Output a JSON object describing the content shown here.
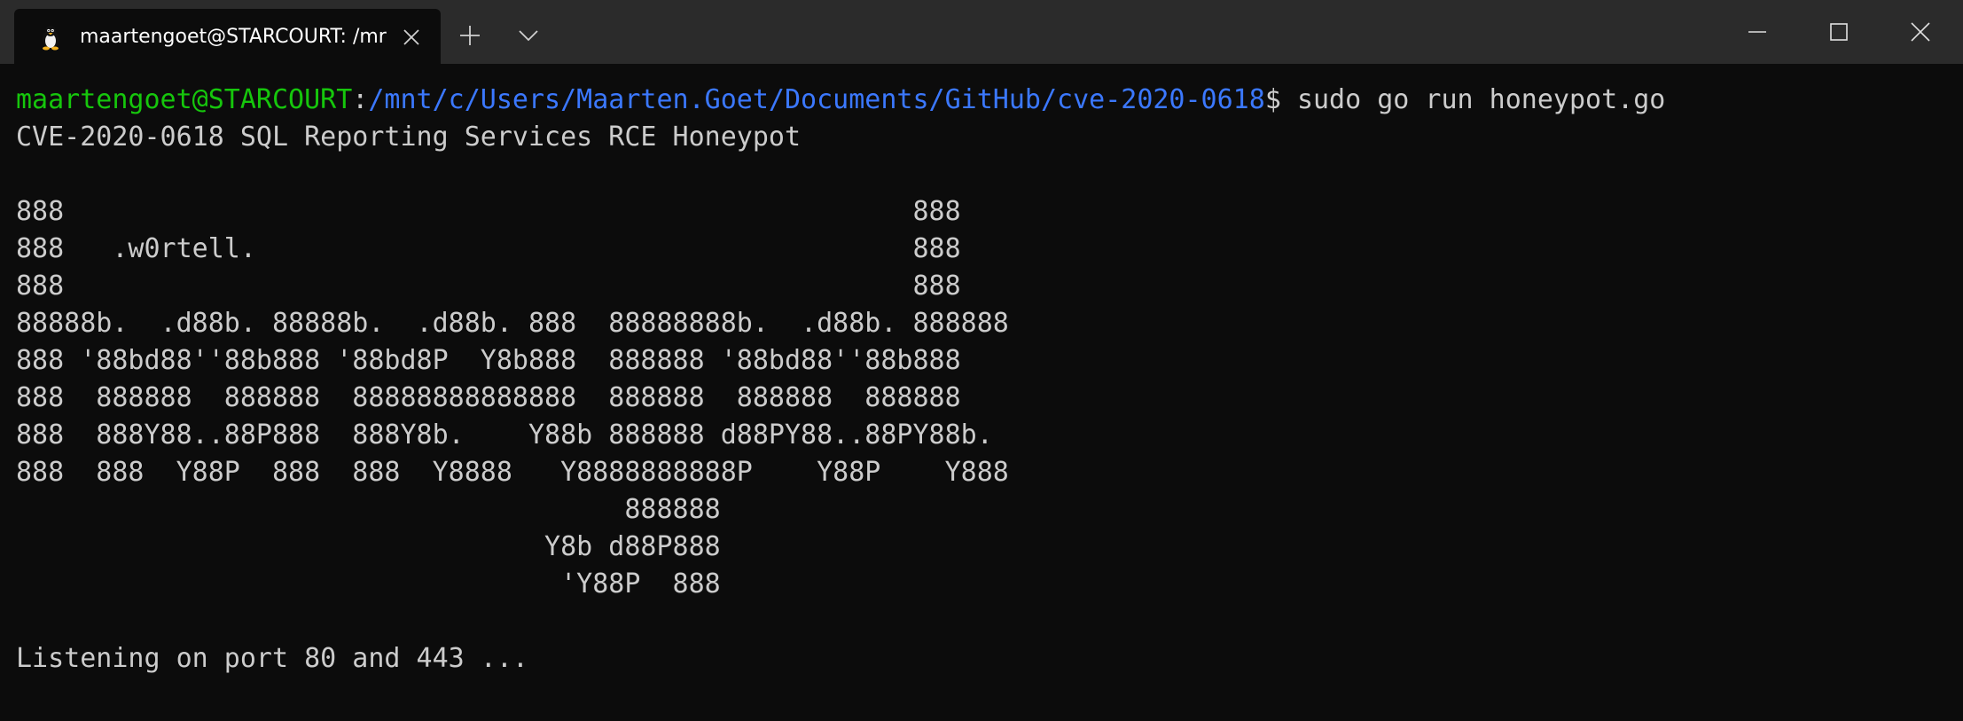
{
  "window": {
    "tab_title": "maartengoet@STARCOURT: /mr",
    "tab_icon": "linux-penguin-icon",
    "colors": {
      "background": "#0c0c0c",
      "titlebar": "#2b2b2b",
      "text": "#cccccc",
      "user": "#16c60c",
      "path": "#3b78ff"
    }
  },
  "terminal": {
    "prompt": {
      "user_host": "maartengoet@STARCOURT",
      "separator": ":",
      "path": "/mnt/c/Users/Maarten.Goet/Documents/GitHub/cve-2020-0618",
      "symbol": "$ ",
      "command": "sudo go run honeypot.go"
    },
    "output": [
      "CVE-2020-0618 SQL Reporting Services RCE Honeypot",
      "",
      "888                                                     888",
      "888   .w0rtell.                                         888",
      "888                                                     888",
      "88888b.  .d88b. 88888b.  .d88b. 888  88888888b.  .d88b. 888888",
      "888 '88bd88''88b888 '88bd8P  Y8b888  888888 '88bd88''88b888",
      "888  888888  888888  88888888888888  888888  888888  888888",
      "888  888Y88..88P888  888Y8b.    Y88b 888888 d88PY88..88PY88b.",
      "888  888  Y88P  888  888  Y8888   Y8888888888P    Y88P    Y888",
      "                                      888888",
      "                                 Y8b d88P888",
      "                                  'Y88P  888",
      "",
      "Listening on port 80 and 443 ..."
    ]
  }
}
